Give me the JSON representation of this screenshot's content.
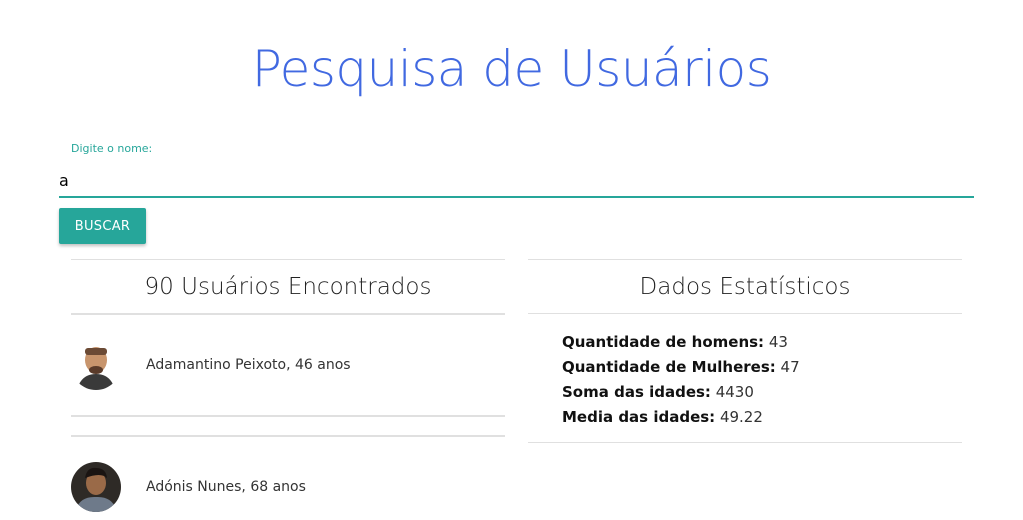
{
  "header": {
    "title": "Pesquisa de Usuários"
  },
  "search": {
    "label": "Digite o nome:",
    "value": "a",
    "button_label": "BUSCAR"
  },
  "users_panel": {
    "title": "90 Usuários Encontrados",
    "users": [
      {
        "name": "Adamantino Peixoto, 46 anos"
      },
      {
        "name": "Adónis Nunes, 68 anos"
      }
    ]
  },
  "stats_panel": {
    "title": "Dados Estatísticos",
    "rows": [
      {
        "label": "Quantidade de homens:",
        "value": "43"
      },
      {
        "label": "Quantidade de Mulheres:",
        "value": "47"
      },
      {
        "label": "Soma das idades:",
        "value": "4430"
      },
      {
        "label": "Media das idades:",
        "value": "49.22"
      }
    ]
  },
  "colors": {
    "title": "#4169e1",
    "accent": "#26a69a"
  }
}
